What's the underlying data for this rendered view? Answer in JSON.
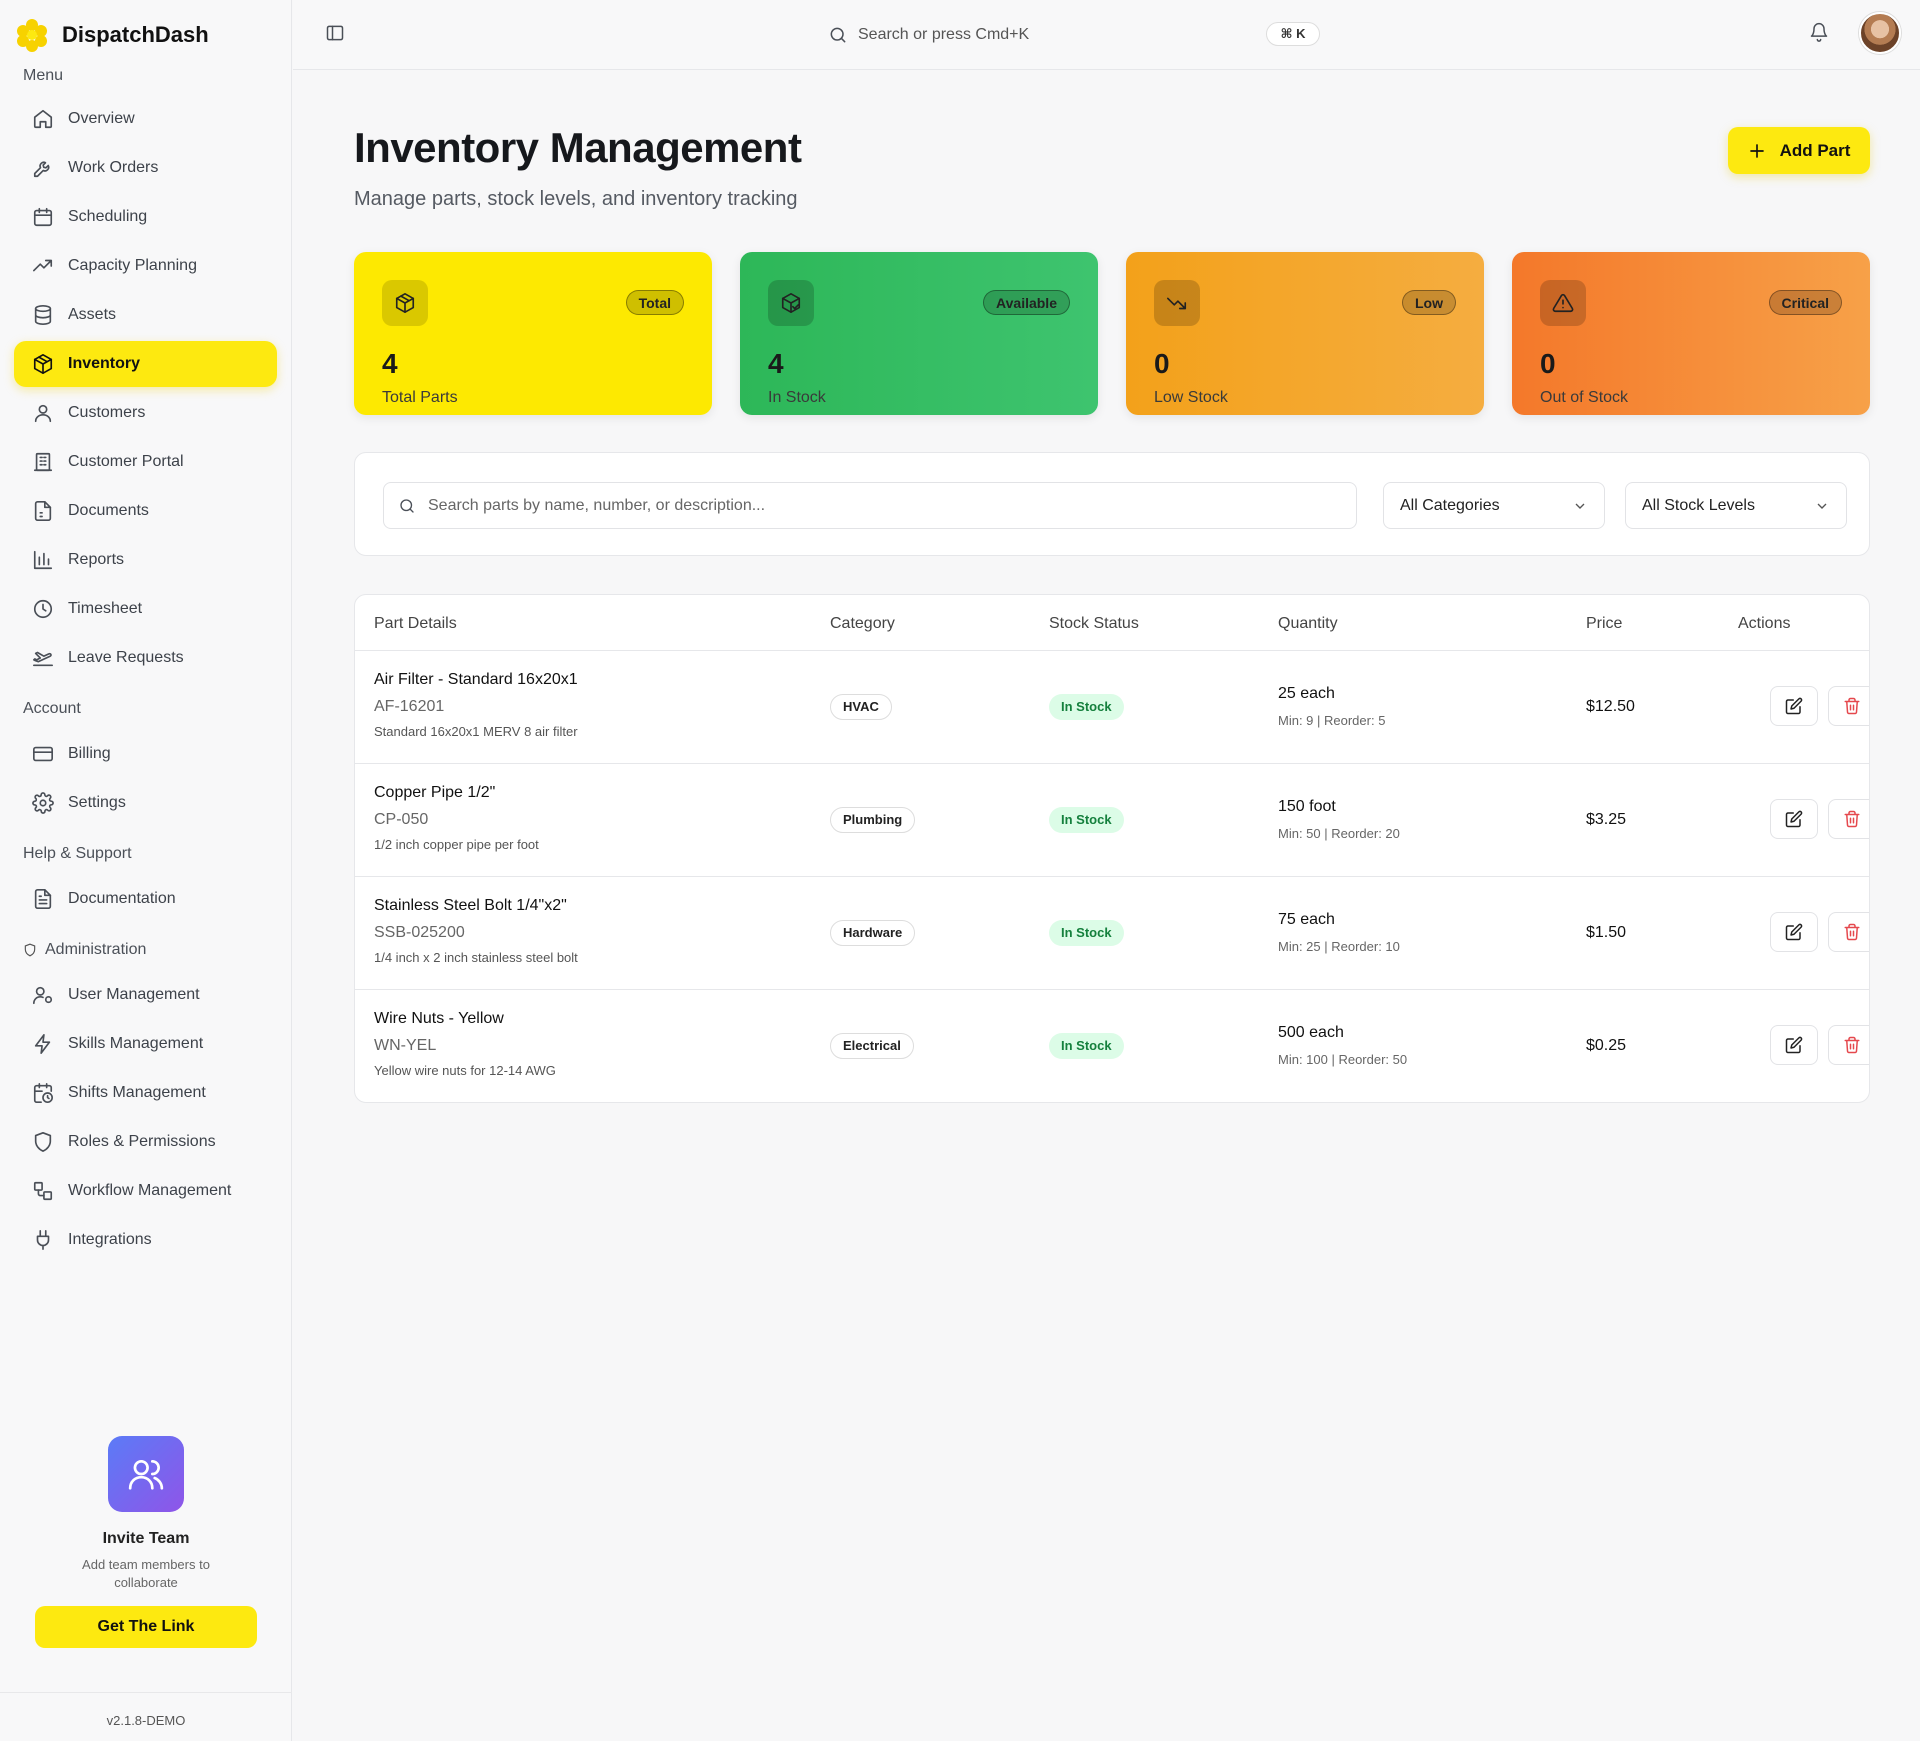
{
  "brand": {
    "name": "DispatchDash"
  },
  "sidebar": {
    "menu_title": "Menu",
    "menu": [
      {
        "label": "Overview",
        "icon": "home-icon"
      },
      {
        "label": "Work Orders",
        "icon": "wrench-icon"
      },
      {
        "label": "Scheduling",
        "icon": "calendar-icon"
      },
      {
        "label": "Capacity Planning",
        "icon": "trending-up-icon"
      },
      {
        "label": "Assets",
        "icon": "database-icon"
      },
      {
        "label": "Inventory",
        "icon": "package-icon",
        "active": true
      },
      {
        "label": "Customers",
        "icon": "user-icon"
      },
      {
        "label": "Customer Portal",
        "icon": "building-icon"
      },
      {
        "label": "Documents",
        "icon": "file-icon"
      },
      {
        "label": "Reports",
        "icon": "bar-chart-icon"
      },
      {
        "label": "Timesheet",
        "icon": "clock-icon"
      },
      {
        "label": "Leave Requests",
        "icon": "plane-icon"
      }
    ],
    "account_title": "Account",
    "account": [
      {
        "label": "Billing",
        "icon": "credit-card-icon"
      },
      {
        "label": "Settings",
        "icon": "gear-icon"
      }
    ],
    "help_title": "Help & Support",
    "help": [
      {
        "label": "Documentation",
        "icon": "document-icon"
      }
    ],
    "admin_title": "Administration",
    "admin": [
      {
        "label": "User Management",
        "icon": "user-cog-icon"
      },
      {
        "label": "Skills Management",
        "icon": "zap-icon"
      },
      {
        "label": "Shifts Management",
        "icon": "calendar-clock-icon"
      },
      {
        "label": "Roles & Permissions",
        "icon": "shield-icon"
      },
      {
        "label": "Workflow Management",
        "icon": "workflow-icon"
      },
      {
        "label": "Integrations",
        "icon": "plug-icon"
      }
    ],
    "invite": {
      "title": "Invite Team",
      "subtitle": "Add team members to collaborate",
      "button": "Get The Link"
    },
    "version": "v2.1.8-DEMO"
  },
  "topbar": {
    "search_placeholder": "Search or press Cmd+K",
    "shortcut": "⌘ K"
  },
  "page": {
    "title": "Inventory Management",
    "subtitle": "Manage parts, stock levels, and inventory tracking",
    "add_button": "Add Part"
  },
  "stats": [
    {
      "badge": "Total",
      "value": "4",
      "label": "Total Parts",
      "icon": "package-icon"
    },
    {
      "badge": "Available",
      "value": "4",
      "label": "In Stock",
      "icon": "package-check-icon"
    },
    {
      "badge": "Low",
      "value": "0",
      "label": "Low Stock",
      "icon": "trending-down-icon"
    },
    {
      "badge": "Critical",
      "value": "0",
      "label": "Out of Stock",
      "icon": "alert-triangle-icon"
    }
  ],
  "filters": {
    "search_placeholder": "Search parts by name, number, or description...",
    "category": "All Categories",
    "stock_level": "All Stock Levels"
  },
  "table": {
    "headers": [
      "Part Details",
      "Category",
      "Stock Status",
      "Quantity",
      "Price",
      "Actions"
    ],
    "rows": [
      {
        "name": "Air Filter - Standard 16x20x1",
        "number": "AF-16201",
        "description": "Standard 16x20x1 MERV 8 air filter",
        "category": "HVAC",
        "status": "In Stock",
        "quantity": "25 each",
        "minmax": "Min: 9 | Reorder: 5",
        "price": "$12.50"
      },
      {
        "name": "Copper Pipe 1/2\"",
        "number": "CP-050",
        "description": "1/2 inch copper pipe per foot",
        "category": "Plumbing",
        "status": "In Stock",
        "quantity": "150 foot",
        "minmax": "Min: 50 | Reorder: 20",
        "price": "$3.25"
      },
      {
        "name": "Stainless Steel Bolt 1/4\"x2\"",
        "number": "SSB-025200",
        "description": "1/4 inch x 2 inch stainless steel bolt",
        "category": "Hardware",
        "status": "In Stock",
        "quantity": "75 each",
        "minmax": "Min: 25 | Reorder: 10",
        "price": "$1.50"
      },
      {
        "name": "Wire Nuts - Yellow",
        "number": "WN-YEL",
        "description": "Yellow wire nuts for 12-14 AWG",
        "category": "Electrical",
        "status": "In Stock",
        "quantity": "500 each",
        "minmax": "Min: 100 | Reorder: 50",
        "price": "$0.25"
      }
    ]
  }
}
